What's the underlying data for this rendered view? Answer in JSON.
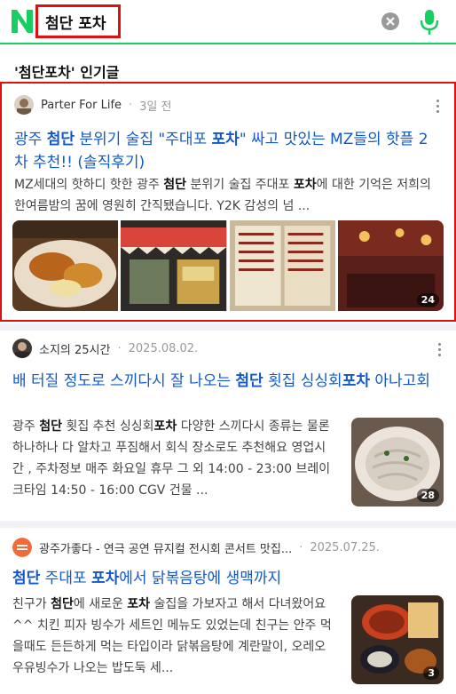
{
  "search": {
    "query": "첨단 포차"
  },
  "section": {
    "title": "'첨단포차' 인기글"
  },
  "posts": [
    {
      "author": "Parter For Life",
      "date": "3일 전",
      "title_parts": [
        "광주 ",
        "첨단",
        " 분위기 술집 \"주대포 ",
        "포차",
        "\" 싸고 맛있는 MZ들의 핫플 2차 추천!! (솔직후기)"
      ],
      "desc_parts": [
        "MZ세대의 핫하디 핫한 광주 ",
        "첨단",
        " 분위기 술집 주대포 ",
        "포차",
        "에 대한 기억은 저희의 한여름밤의 꿈에 영원히 간직됐습니다. Y2K 감성의 넘 ..."
      ],
      "image_count": "24"
    },
    {
      "author": "소지의 25시간",
      "date": "2025.08.02.",
      "title_parts": [
        "배 터질 정도로 스끼다시 잘 나오는 ",
        "첨단",
        " 횟집 싱싱회",
        "포차",
        " 아나고회"
      ],
      "desc_parts": [
        "광주 ",
        "첨단",
        " 횟집 추천 싱싱회",
        "포차",
        " 다양한 스끼다시 종류는 물론 하나하나 다 알차고 푸짐해서 회식 장소로도 추천해요 영업시간 , 주차정보 매주 화요일 휴무 그 외 14:00 - 23:00 브레이크타임 14:50 - 16:00 CGV 건물 ..."
      ],
      "image_count": "28"
    },
    {
      "author": "광주가좋다 - 연극 공연 뮤지컬 전시회 콘서트 맛집...",
      "date": "2025.07.25.",
      "title_parts": [
        "첨단",
        " 주대포 ",
        "포차",
        "에서 닭볶음탕에 생맥까지"
      ],
      "desc_parts": [
        "친구가 ",
        "첨단",
        "에 새로운 ",
        "포차",
        " 술집을 가보자고 해서 다녀왔어요^^ 치킨 피자 빙수가 세트인 메뉴도 있었는데 친구는 안주 먹을때도 든든하게 먹는 타입이라 닭볶음탕에 계란말이, 오레오 우유빙수가 나오는 밥도둑 세..."
      ],
      "image_count": "3"
    }
  ],
  "colors": {
    "accent": "#19ce60",
    "link": "#1458c8",
    "highlight_border": "#e01010"
  }
}
